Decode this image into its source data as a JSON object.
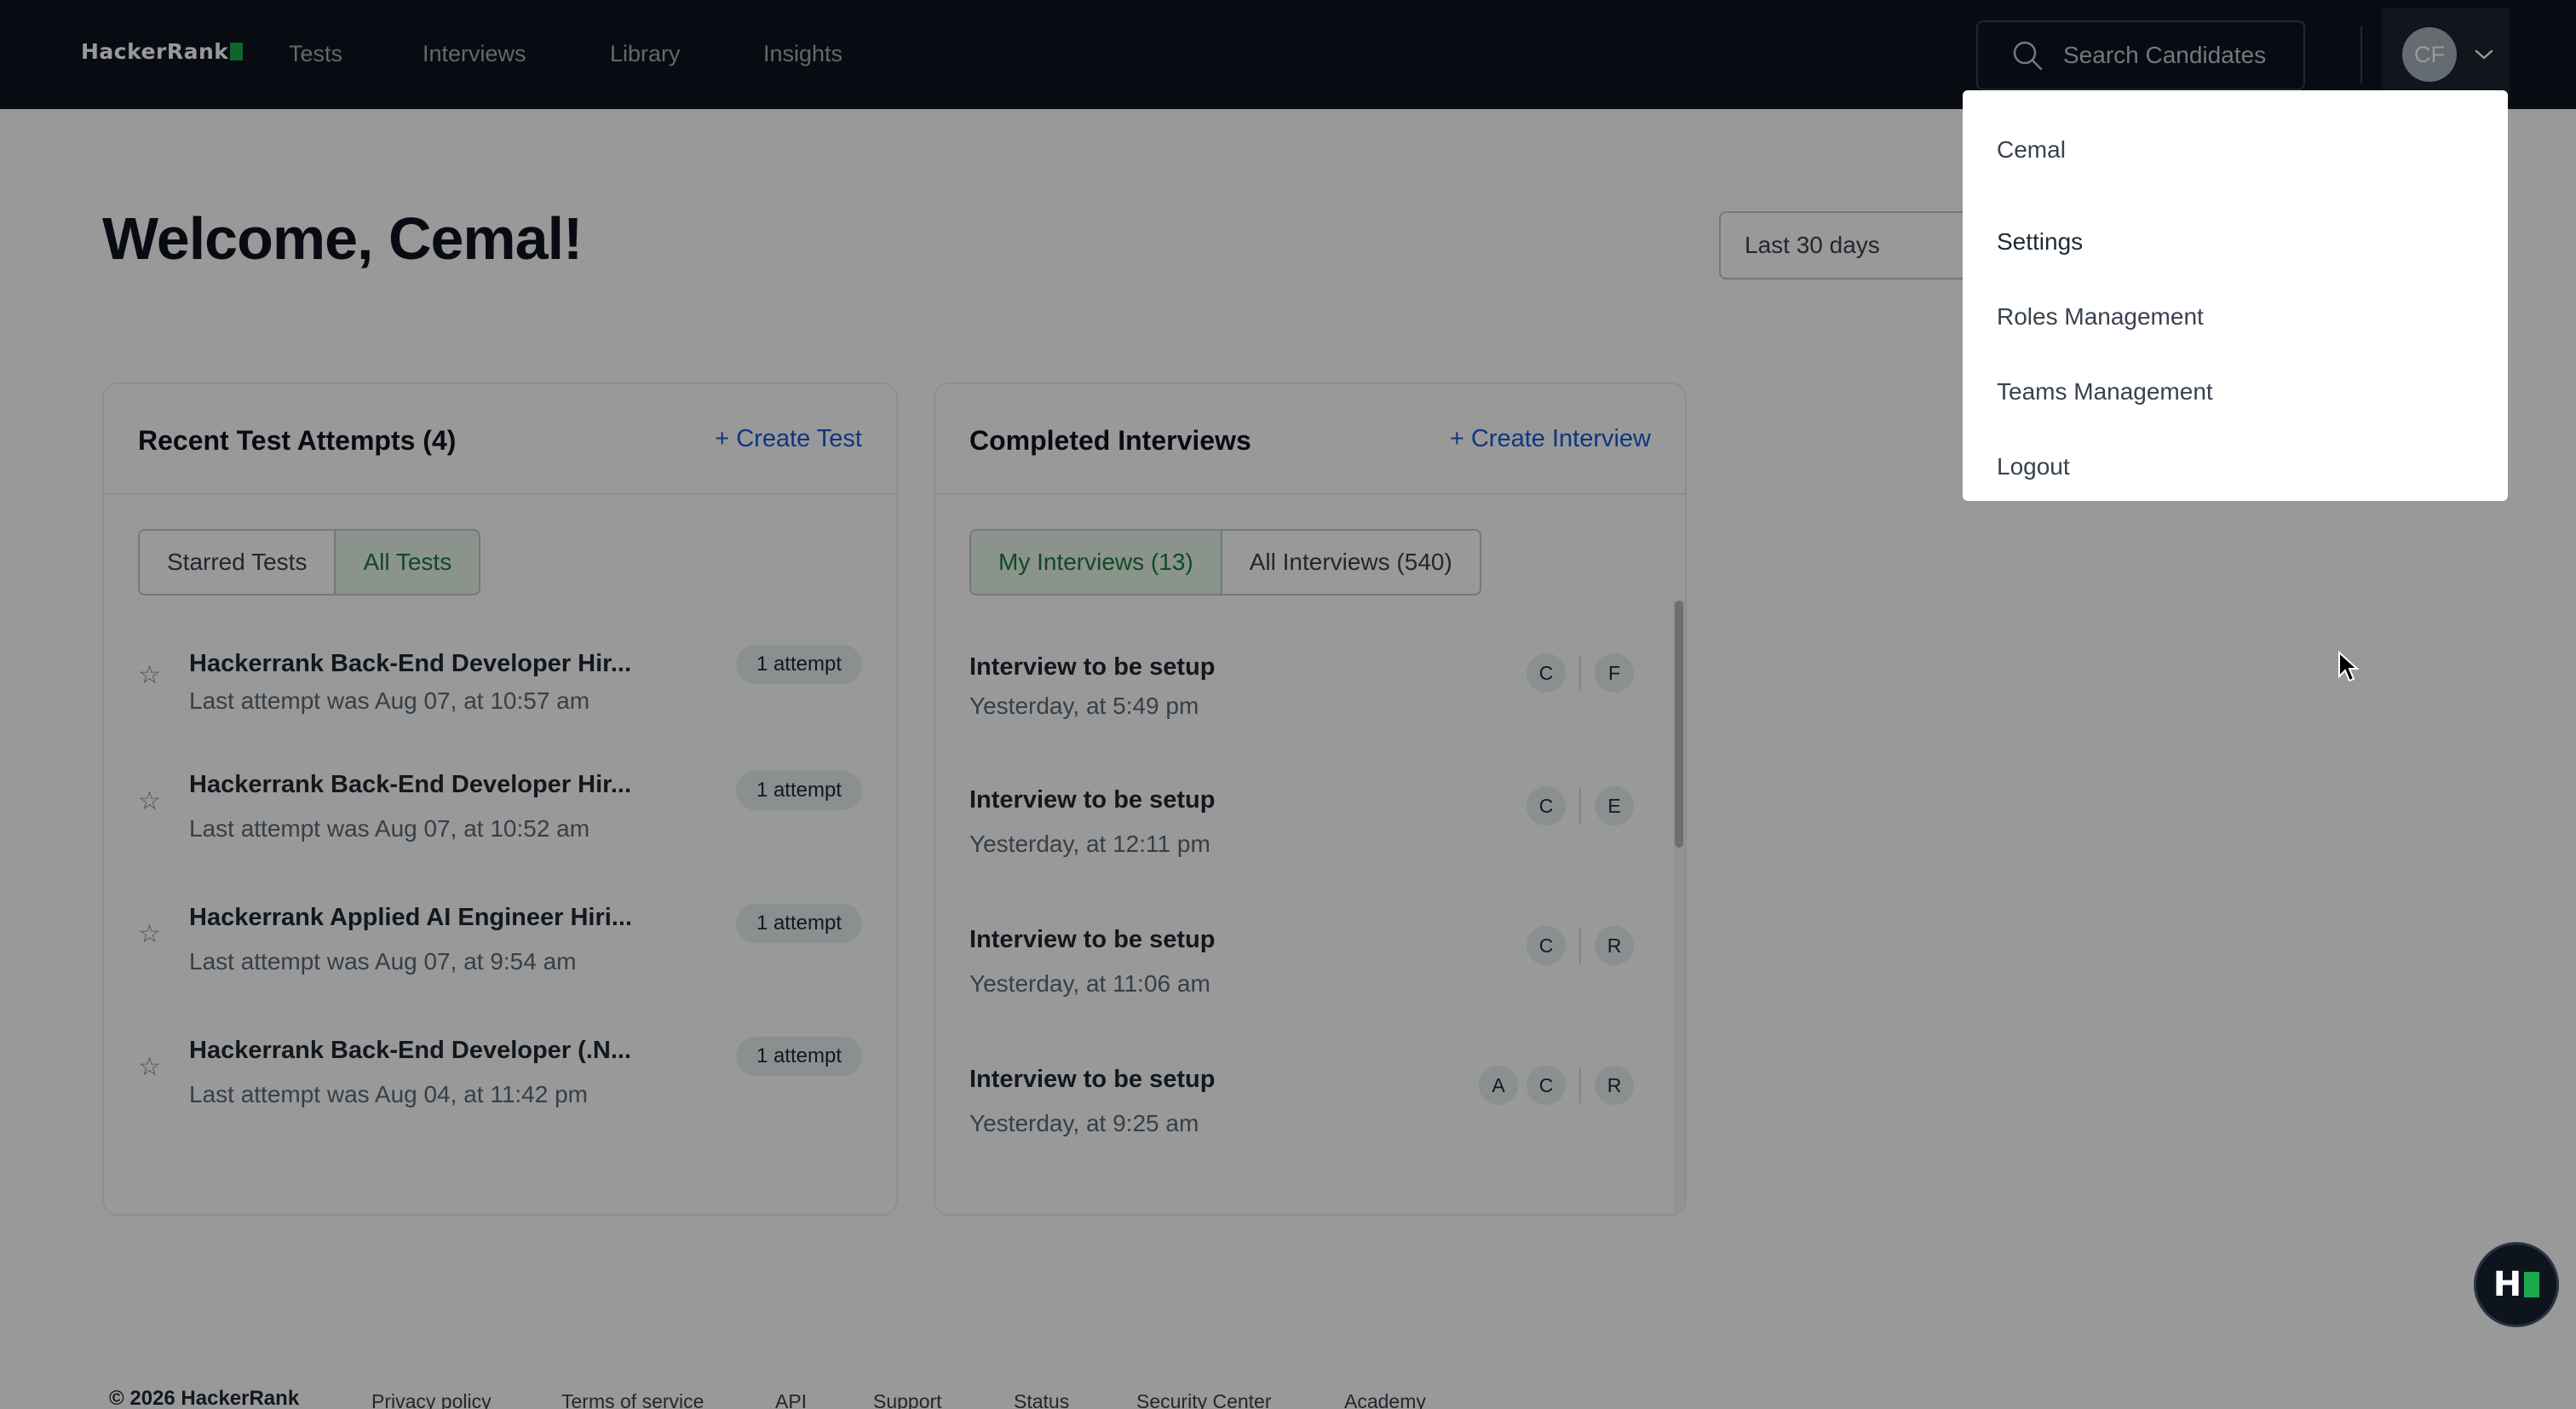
{
  "app": {
    "brand": "HackerRank",
    "accent_color": "#1ba94c",
    "nav_background": "#0e141e",
    "link_color": "#1a5ad7"
  },
  "topnav": {
    "links": [
      "Tests",
      "Interviews",
      "Library",
      "Insights"
    ],
    "search": {
      "placeholder": "Search Candidates",
      "icon": "search-icon"
    },
    "profile": {
      "initials": "CF",
      "icon": "chevron-down-icon"
    }
  },
  "page": {
    "welcome": "Welcome, Cemal!",
    "date_range": "Last 30 days"
  },
  "tests_card": {
    "title": "Recent Test Attempts (4)",
    "action": "+ Create Test",
    "toggles": [
      {
        "label": "Starred Tests",
        "active": false
      },
      {
        "label": "All Tests",
        "active": true
      }
    ],
    "rows": [
      {
        "title": "Hackerrank Back-End Developer Hir...",
        "subtitle": "Last attempt was Aug 07, at 10:57 am",
        "badge": "1 attempt",
        "starred": false
      },
      {
        "title": "Hackerrank Back-End Developer Hir...",
        "subtitle": "Last attempt was Aug 07, at 10:52 am",
        "badge": "1 attempt",
        "starred": false
      },
      {
        "title": "Hackerrank Applied AI Engineer Hiri...",
        "subtitle": "Last attempt was Aug 07, at 9:54 am",
        "badge": "1 attempt",
        "starred": false
      },
      {
        "title": "Hackerrank Back-End Developer (.N...",
        "subtitle": "Last attempt was Aug 04, at 11:42 pm",
        "badge": "1 attempt",
        "starred": false
      }
    ]
  },
  "interviews_card": {
    "title": "Completed Interviews",
    "action": "+ Create Interview",
    "toggles": [
      {
        "label": "My Interviews (13)",
        "active": true
      },
      {
        "label": "All Interviews (540)",
        "active": false
      }
    ],
    "rows": [
      {
        "title": "Interview to be setup",
        "subtitle": "Yesterday, at 5:49 pm",
        "interviewers": [
          "C"
        ],
        "candidate": "F"
      },
      {
        "title": "Interview to be setup",
        "subtitle": "Yesterday, at 12:11 pm",
        "interviewers": [
          "C"
        ],
        "candidate": "E"
      },
      {
        "title": "Interview to be setup",
        "subtitle": "Yesterday, at 11:06 am",
        "interviewers": [
          "C"
        ],
        "candidate": "R"
      },
      {
        "title": "Interview to be setup",
        "subtitle": "Yesterday, at 9:25 am",
        "interviewers": [
          "A",
          "C"
        ],
        "candidate": "R"
      }
    ]
  },
  "footer": {
    "copyright": "© 2026 HackerRank",
    "links": [
      "Privacy policy",
      "Terms of service",
      "API",
      "Support",
      "Status",
      "Security Center",
      "Academy"
    ]
  },
  "profile_menu": {
    "user_name": "Cemal",
    "items": [
      "Settings",
      "Roles Management",
      "Teams Management",
      "Logout"
    ],
    "highlighted": "Settings"
  }
}
